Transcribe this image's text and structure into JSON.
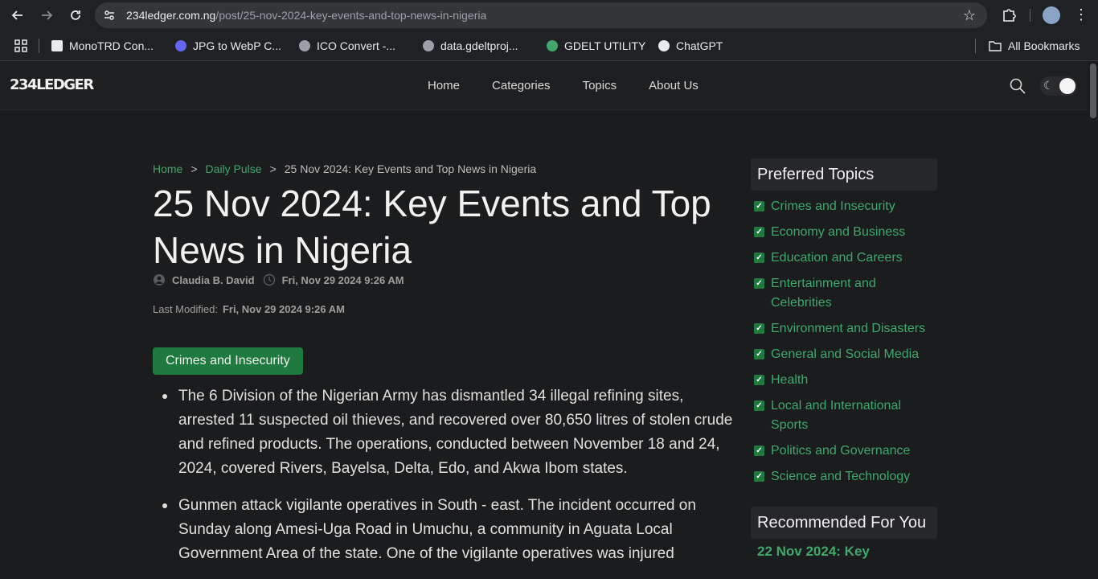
{
  "browser": {
    "url_host": "234ledger.com.ng",
    "url_path": "/post/25-nov-2024-key-events-and-top-news-in-nigeria",
    "bookmarks": [
      {
        "label": "MonoTRD Con...",
        "icon": "g-favicon"
      },
      {
        "label": "JPG to WebP C...",
        "icon": "blue-circle-favicon"
      },
      {
        "label": "ICO Convert -...",
        "icon": "globe-favicon"
      },
      {
        "label": "data.gdeltproj...",
        "icon": "globe-favicon"
      },
      {
        "label": "GDELT UTILITY",
        "icon": "green-circle-favicon"
      },
      {
        "label": "ChatGPT",
        "icon": "chatgpt-favicon"
      }
    ],
    "all_bookmarks_label": "All Bookmarks"
  },
  "site": {
    "logo": "234LEDGER",
    "nav": [
      "Home",
      "Categories",
      "Topics",
      "About Us"
    ]
  },
  "breadcrumb": {
    "home": "Home",
    "sep": ">",
    "section": "Daily Pulse",
    "current": "25 Nov 2024: Key Events and Top News in Nigeria"
  },
  "article": {
    "title": "25 Nov 2024: Key Events and Top News in Nigeria",
    "author": "Claudia B. David",
    "published": "Fri, Nov 29 2024 9:26 AM",
    "modified_label": "Last Modified:",
    "modified": "Fri, Nov 29 2024 9:26 AM",
    "category_tag": "Crimes and Insecurity",
    "bullets": [
      "The 6 Division of the Nigerian Army has dismantled 34 illegal refining sites, arrested 11 suspected oil thieves, and recovered over 80,650 litres of stolen crude and refined products. The operations, conducted between November 18 and 24, 2024, covered Rivers, Bayelsa, Delta, Edo, and Akwa Ibom states.",
      "Gunmen attack vigilante operatives in South - east. The incident occurred on Sunday along Amesi-Uga Road in Umuchu, a community in Aguata Local Government Area of the state. One of the vigilante operatives was injured"
    ]
  },
  "sidebar": {
    "preferred_title": "Preferred Topics",
    "topics": [
      "Crimes and Insecurity",
      "Economy and Business",
      "Education and Careers",
      "Entertainment and Celebrities",
      "Environment and Disasters",
      "General and Social Media",
      "Health",
      "Local and International Sports",
      "Politics and Governance",
      "Science and Technology"
    ],
    "recommended_title": "Recommended For You",
    "recommended_first": "22 Nov 2024: Key"
  },
  "colors": {
    "accent_green": "#3fa86a",
    "tag_green": "#1f7a3f",
    "background": "#1b1c1e"
  }
}
